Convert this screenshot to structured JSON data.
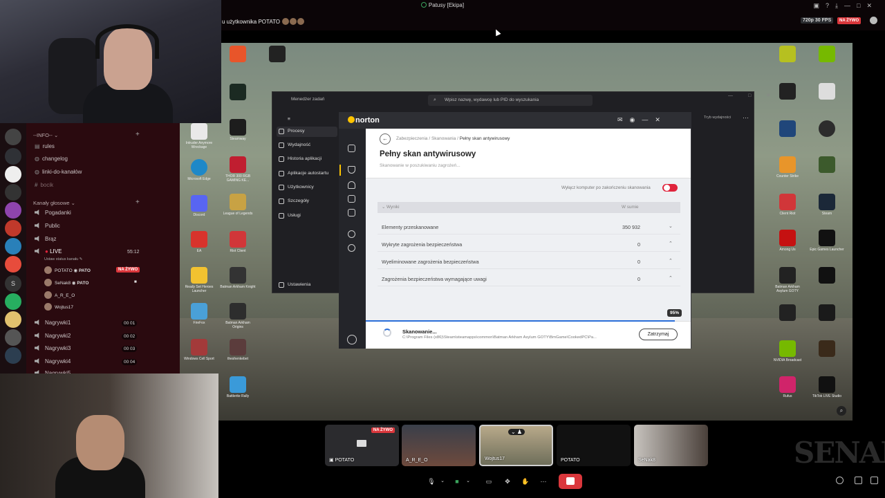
{
  "window": {
    "title": "Patusy [Ekipa]"
  },
  "stream": {
    "viewer_title": "u użytkownika POTATO",
    "quality_badge": "720p 30 FPS",
    "live_badge": "NA ŻYWO"
  },
  "sidebar": {
    "categories": [
      {
        "label": "--INFO--"
      },
      {
        "label": "Kanały głosowe"
      }
    ],
    "text_channels": [
      "rules",
      "changelog",
      "linki-do-kanałów",
      "bocik"
    ],
    "voice_channels": [
      "Pogadanki",
      "Public",
      "Brąz",
      "LIVE"
    ],
    "live": {
      "timer": "55:12",
      "status": "Ustaw status kanału",
      "users": [
        {
          "name": "POTATO",
          "tag": "PATO",
          "badge": "NA ŻYWO"
        },
        {
          "name": "SeNak8",
          "tag": "PATO"
        },
        {
          "name": "A_R_E_O"
        },
        {
          "name": "Wojtus17"
        }
      ]
    },
    "recording_channels": [
      {
        "name": "Nagrywki1",
        "count_a": "00",
        "count_b": "01"
      },
      {
        "name": "Nagrywki2",
        "count_a": "00",
        "count_b": "02"
      },
      {
        "name": "Nagrywki3",
        "count_a": "00",
        "count_b": "03"
      },
      {
        "name": "Nagrywki4",
        "count_a": "00",
        "count_b": "04"
      },
      {
        "name": "Nagrywki5"
      }
    ]
  },
  "desktop": {
    "icons_left": [
      "Intruder Anymore Wreckage",
      "Microsoft Edge",
      "Discord",
      "EA",
      "Ready Set Heroes Launcher",
      "FireFox",
      "Windows Cell Sport",
      "Escape from Tarkov",
      "Battlerite Rally"
    ],
    "icons_mid": [
      "Steamway",
      "ClassicBomb",
      "THOR 300 RGB GAMING KE...",
      "League of Legends",
      "Riot Client",
      "Batman Arkham Knight",
      "Batman Arkham Origins",
      "theshenkebet"
    ],
    "icons_right": [
      "Valorant",
      "Counter Strike",
      "Among Us",
      "Batman Arkham Asylum GOTY",
      "NVIDIA Broadcast",
      "Rufus",
      "Epic Games Launcher",
      "Steam",
      "Client Riot",
      "TikTok LIVE Studio"
    ]
  },
  "task_manager": {
    "title": "Menedżer zadań",
    "search_placeholder": "Wpisz nazwę, wydawcę lub PID do wyszukania",
    "mode": "Tryb wydajności",
    "nav": [
      "Procesy",
      "Wydajność",
      "Historia aplikacji",
      "Aplikacje autostartu",
      "Użytkownicy",
      "Szczegóły",
      "Usługi"
    ],
    "settings": "Ustawienia"
  },
  "norton": {
    "brand": "norton",
    "breadcrumb": [
      "Zabezpieczenia",
      "Skanowania",
      "Pełny skan antywirusowy"
    ],
    "title": "Pełny skan antywirusowy",
    "subtitle": "Skanowanie w poszukiwaniu zagrożeń...",
    "shutdown_option": "Wyłącz komputer po zakończeniu skanowania",
    "shutdown_enabled": false,
    "table": {
      "col_results": "Wyniki",
      "col_total": "W sumie",
      "rows": [
        {
          "label": "Elementy przeskanowane",
          "value": "350 932"
        },
        {
          "label": "Wykryte zagrożenia bezpieczeństwa",
          "value": "0"
        },
        {
          "label": "Wyeliminowane zagrożenia bezpieczeństwa",
          "value": "0"
        },
        {
          "label": "Zagrożenia bezpieczeństwa wymagające uwagi",
          "value": "0"
        }
      ]
    },
    "progress_percent": 95,
    "progress_label": "95%",
    "status": "Skanowanie...",
    "current_path": "C:\\Program Files (x86)\\Steam\\steamapps\\common\\Batman Arkham Asylum GOTY\\BmGame\\CookedPC\\Pa...",
    "stop_button": "Zatrzymaj"
  },
  "participants": [
    {
      "name": "POTATO",
      "live": "NA ŻYWO"
    },
    {
      "name": "A_R_E_O"
    },
    {
      "name": "Wojtus17"
    },
    {
      "name": "POTATO"
    },
    {
      "name": "SeNak8"
    }
  ],
  "watermark": "SENAK",
  "colors": {
    "discord_red": "#da373c",
    "norton_yellow": "#fec300",
    "progress_blue": "#2a6ed8",
    "sidebar_bg": "#2a0a0f"
  }
}
